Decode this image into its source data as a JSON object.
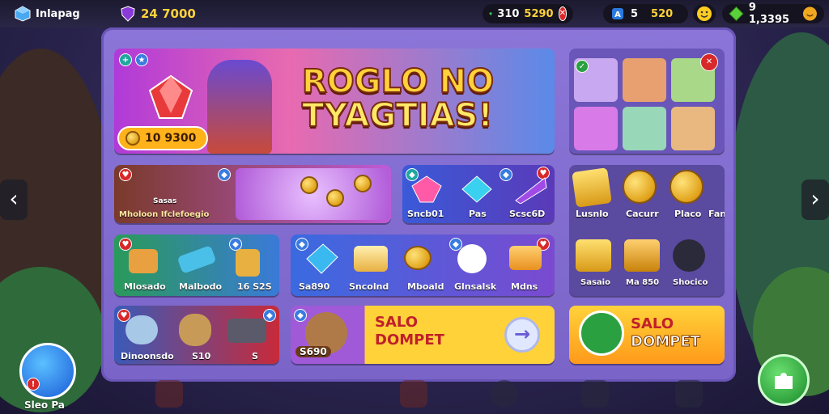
{
  "header": {
    "app_name": "Inlapag",
    "level_text": "24 7000",
    "gems": "310",
    "coins": "5290",
    "tickets": "5",
    "energy": "520",
    "gold": "9 1,3395"
  },
  "hero": {
    "title_line1": "ROGLO NO",
    "title_line2": "TYAGTIAS!",
    "price": "10 9300"
  },
  "row1": {
    "pack_a": "Mholoon Ifclefoegio",
    "pack_a_sub": "Sasas",
    "gem_a": "Sncb01",
    "gem_b": "Pas",
    "gem_c": "Scsc6D"
  },
  "row2": {
    "item_a": "Mlosado",
    "item_b": "Malbodo",
    "item_c": "16 S2S",
    "item_d": "Sa890",
    "item_e": "Sncolnd",
    "item_f": "Mboald",
    "item_g": "Glnsalsk",
    "item_h": "Mdns"
  },
  "row3": {
    "pack_a": "Dinoonsdo",
    "pack_b": "S10",
    "pack_c": "S",
    "price": "S690",
    "sale_title": "SALO",
    "sale_sub": "DOMPET",
    "sale2_title": "SALO",
    "sale2_sub": "DOMPET"
  },
  "right_col": {
    "r1": "Lusnlo",
    "r2": "Cacurr",
    "r3": "Placo",
    "r4": "Fanlio",
    "r5": "Sasaio",
    "r6": "Ma 850",
    "r7": "Shocico"
  },
  "bottom_left": {
    "label": "Sleo Pa"
  },
  "colors": {
    "panel": "#8b76d8",
    "accent_yellow": "#ffd23a",
    "sale_orange": "#ffb21a"
  }
}
